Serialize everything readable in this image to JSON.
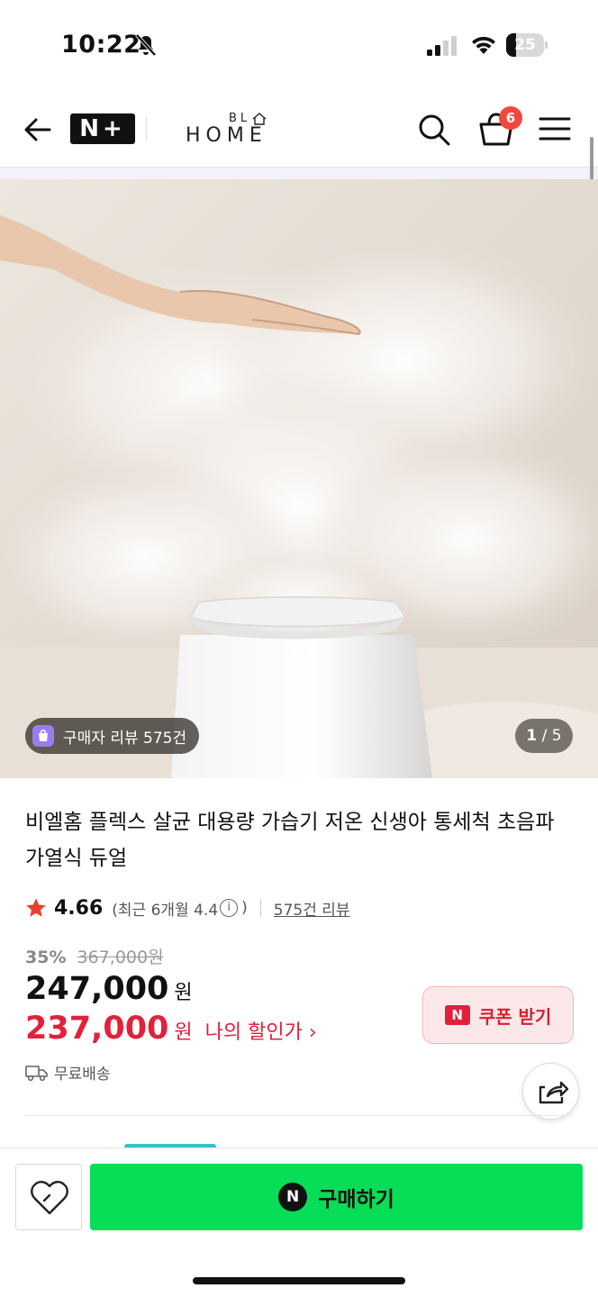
{
  "status_bar": {
    "time": "10:22",
    "battery_level": 25,
    "battery_text": "25"
  },
  "header": {
    "nplus_logo": "N+",
    "brand_main": "HOME",
    "brand_small": "BL",
    "cart_count": "6"
  },
  "hero": {
    "review_pill": "구매자 리뷰 575건",
    "page_current": "1",
    "page_total": "/ 5"
  },
  "product": {
    "title": "비엘홈 플렉스 살균 대용량 가습기 저온 신생아 통세척 초음파 가열식 듀얼",
    "rating": "4.66",
    "recent_rating": "(최근 6개월 4.4",
    "recent_rating_close": ")",
    "review_link": "575건 리뷰",
    "discount_rate": "35%",
    "original_price": "367,000원",
    "price": "247,000",
    "won": "원",
    "my_price": "237,000",
    "my_won": "원",
    "my_price_label": "나의 할인가 ›",
    "coupon_n": "N",
    "coupon_label": "쿠폰 받기",
    "delivery": "무료배송"
  },
  "bottom": {
    "buy_n": "N",
    "buy_label": "구매하기"
  },
  "colors": {
    "buy_green": "#07dd57",
    "discount_red": "#e3203a",
    "star_red": "#e8402e",
    "badge_red": "#f0483e"
  }
}
